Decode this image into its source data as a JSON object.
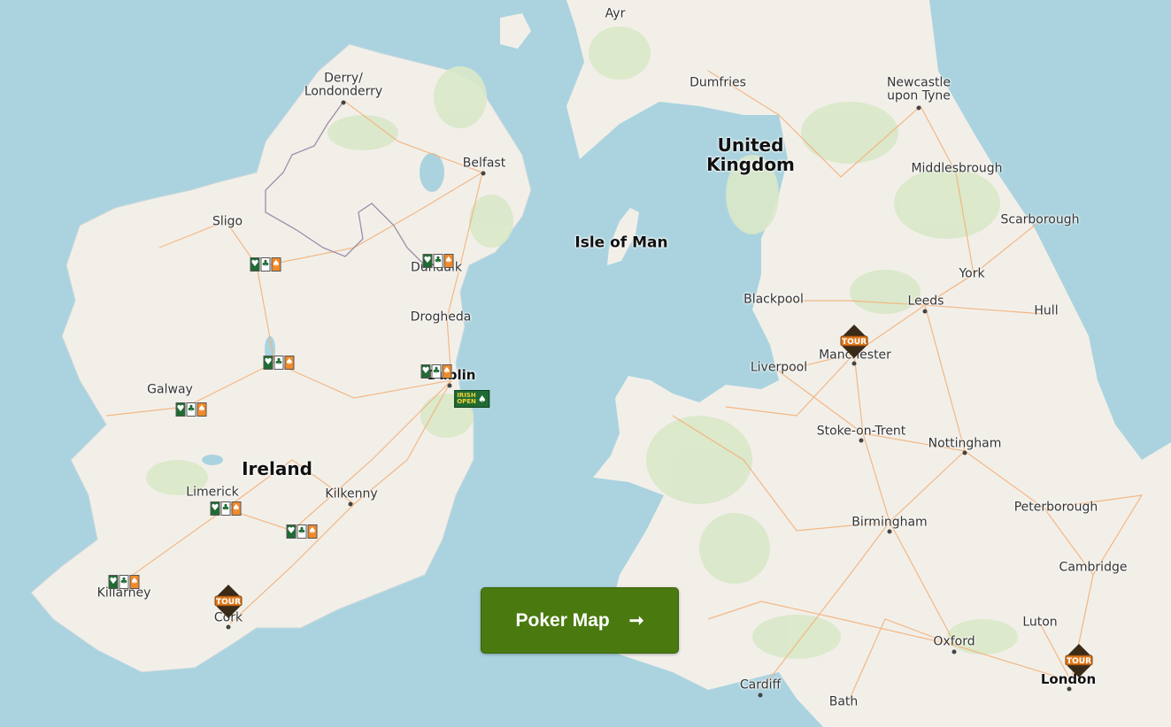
{
  "colors": {
    "sea": "#aad3df",
    "land": "#f2efe9",
    "green": "#d9e8c8",
    "road": "#f4b27a",
    "border": "#9a8fa8",
    "button": "#4a7a0f"
  },
  "labels": {
    "ayr": "Ayr",
    "dumfries": "Dumfries",
    "newcastle": "Newcastle\nupon Tyne",
    "derry": "Derry/\nLondonderry",
    "united_kingdom": "United\nKingdom",
    "belfast": "Belfast",
    "middlesbrough": "Middlesbrough",
    "sligo": "Sligo",
    "scarborough": "Scarborough",
    "isle_of_man": "Isle of Man",
    "dundalk": "Dundalk",
    "york": "York",
    "blackpool": "Blackpool",
    "leeds": "Leeds",
    "drogheda": "Drogheda",
    "hull": "Hull",
    "manchester": "Manchester",
    "liverpool": "Liverpool",
    "dublin": "Dublin",
    "galway": "Galway",
    "stoke": "Stoke-on-Trent",
    "nottingham": "Nottingham",
    "ireland": "Ireland",
    "limerick": "Limerick",
    "kilkenny": "Kilkenny",
    "peterborough": "Peterborough",
    "birmingham": "Birmingham",
    "cambridge": "Cambridge",
    "killarney": "Killarney",
    "cork": "Cork",
    "luton": "Luton",
    "oxford": "Oxford",
    "london": "London",
    "cardiff": "Cardiff",
    "bath": "Bath"
  },
  "markers": {
    "irish_flag_glyphs": [
      "♥",
      "♣",
      "♠"
    ],
    "irish_open_text": "IRISH\nOPEN",
    "irish_open_icon": "spade-card-icon",
    "tour_badge_icon": "poker-tour-badge-icon"
  },
  "cta": {
    "label": "Poker Map",
    "arrow": "➞"
  }
}
